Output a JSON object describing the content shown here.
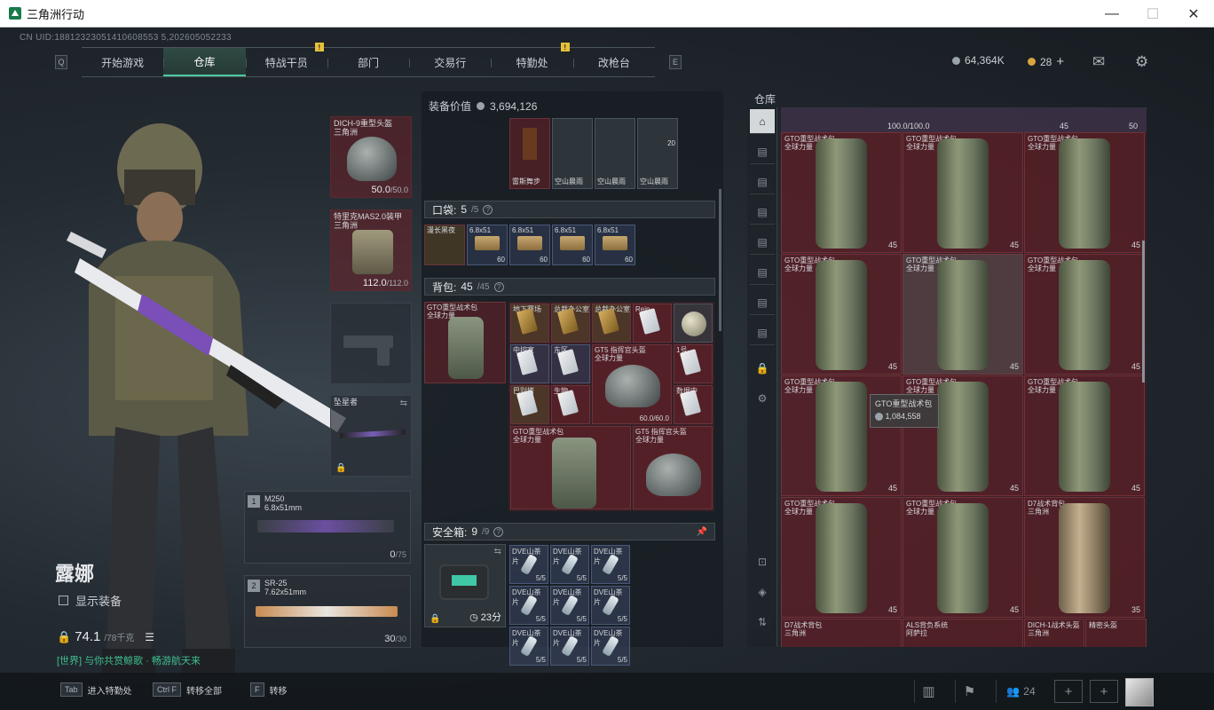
{
  "window": {
    "title": "三角洲行动",
    "minimize": "—",
    "maximize": "☐",
    "close": "✕"
  },
  "uid": "CN UID:18812323051410608553 5,202605052233",
  "nav": {
    "key_left": "Q",
    "key_right": "E",
    "tabs": [
      {
        "label": "开始游戏",
        "active": false,
        "warn": false
      },
      {
        "label": "仓库",
        "active": true,
        "warn": false
      },
      {
        "label": "特战干员",
        "active": false,
        "warn": true
      },
      {
        "label": "部门",
        "active": false,
        "warn": false
      },
      {
        "label": "交易行",
        "active": false,
        "warn": false
      },
      {
        "label": "特勤处",
        "active": false,
        "warn": true
      },
      {
        "label": "改枪台",
        "active": false,
        "warn": false
      }
    ],
    "warn_mark": "!"
  },
  "currency": {
    "silver": "64,364K",
    "gold": "28",
    "add": "+"
  },
  "icons": {
    "mail": "mail-icon",
    "settings": "gear-icon"
  },
  "character": {
    "name": "露娜",
    "show_equipment": "显示装备",
    "weight": "74.1",
    "weight_max": "/78千克",
    "chat": "[世界] 与你共赏鲸歌 · 畅游航天来"
  },
  "equipment": {
    "helmet": {
      "name": "DICH-9重型头盔\n三角洲",
      "dur": "50.0",
      "dur_max": "/50.0"
    },
    "armor": {
      "name": "特里克MAS2.0装甲\n三角洲",
      "dur": "112.0",
      "dur_max": "/112.0"
    },
    "melee": {
      "name": "坠星者"
    },
    "primary": {
      "num": "1",
      "name": "M250\n6.8x51mm",
      "ammo": "0",
      "ammo_max": "/75"
    },
    "secondary": {
      "num": "2",
      "name": "SR-25\n7.62x51mm",
      "ammo": "30",
      "ammo_max": "/30"
    }
  },
  "middle": {
    "value_label": "装备价值",
    "value": "3,694,126",
    "top_items": [
      "雷斯舞步",
      "空山晨雨",
      "空山晨雨",
      "空山晨雨"
    ],
    "top_count": "20",
    "pocket": {
      "label": "口袋:",
      "count": "5",
      "max": "/5",
      "q": "?"
    },
    "pocket_items": [
      {
        "name": "漫长黑夜",
        "count": ""
      },
      {
        "name": "6.8x51",
        "count": "60"
      },
      {
        "name": "6.8x51",
        "count": "60"
      },
      {
        "name": "6.8x51",
        "count": "60"
      },
      {
        "name": "6.8x51",
        "count": "60"
      }
    ],
    "backpack": {
      "label": "背包:",
      "count": "45",
      "max": "/45",
      "q": "?",
      "name": "GTO重型战术包\n全球力量"
    },
    "backpack_items": [
      {
        "name": "地下赛场"
      },
      {
        "name": "总裁办公室"
      },
      {
        "name": "总裁办公室"
      },
      {
        "name": "Rein"
      },
      {
        "name": ""
      },
      {
        "name": ""
      },
      {
        "name": "中控室"
      },
      {
        "name": "东区"
      },
      {
        "name": "1号"
      },
      {
        "name": "巴别塔"
      },
      {
        "name": "生物"
      },
      {
        "name": "数据中"
      }
    ],
    "helmet_item": {
      "name": "GT5 指挥官头盔\n全球力量",
      "dur": "60.0/60.0"
    },
    "bag_items": [
      {
        "name": "GTO重型战术包\n全球力量"
      },
      {
        "name": "GT5 指挥官头盔\n全球力量"
      }
    ],
    "safebox": {
      "label": "安全箱:",
      "count": "9",
      "max": "/9",
      "q": "?",
      "timer": "23分"
    },
    "safe_items": {
      "name": "DVE山茶片",
      "count": "5/5"
    }
  },
  "warehouse": {
    "title": "仓库",
    "header": {
      "dur": "100.0/100.0",
      "count_a": "45",
      "count_b": "50"
    },
    "cells": [
      {
        "name": "GTO重型战术包\n全球力量",
        "count": "45"
      },
      {
        "name": "GTO重型战术包\n全球力量",
        "count": "45"
      },
      {
        "name": "GTO重型战术包\n全球力量",
        "count": "45"
      },
      {
        "name": "GTO重型战术包\n全球力量",
        "count": "45"
      },
      {
        "name": "GTO重型战术包\n全球力量",
        "count": "45"
      },
      {
        "name": "GTO重型战术包\n全球力量",
        "count": "45"
      },
      {
        "name": "GTO重型战术包\n全球力量",
        "count": "45"
      },
      {
        "name": "GTO重型战术包\n全球力量",
        "count": "45"
      },
      {
        "name": "GTO重型战术包\n全球力量",
        "count": "45"
      },
      {
        "name": "GTO重型战术包\n全球力量",
        "count": "45"
      },
      {
        "name": "GTO重型战术包\n全球力量",
        "count": "45"
      },
      {
        "name": "D7战术背包\n三角洲",
        "count": "35"
      }
    ],
    "bottom_row": [
      "D7战术背包\n三角洲",
      "ALS背负系统\n阿萨拉",
      "DICH-1战术头盔\n三角洲",
      "精密头盔"
    ],
    "tooltip": {
      "name": "GTO重型战术包",
      "price": "1,084,558"
    }
  },
  "bottom": {
    "keys": [
      {
        "key": "Tab",
        "label": "进入特勤处"
      },
      {
        "key": "Ctrl F",
        "label": "转移全部"
      },
      {
        "key": "F",
        "label": "转移"
      }
    ],
    "friends": "24",
    "add": "+"
  }
}
